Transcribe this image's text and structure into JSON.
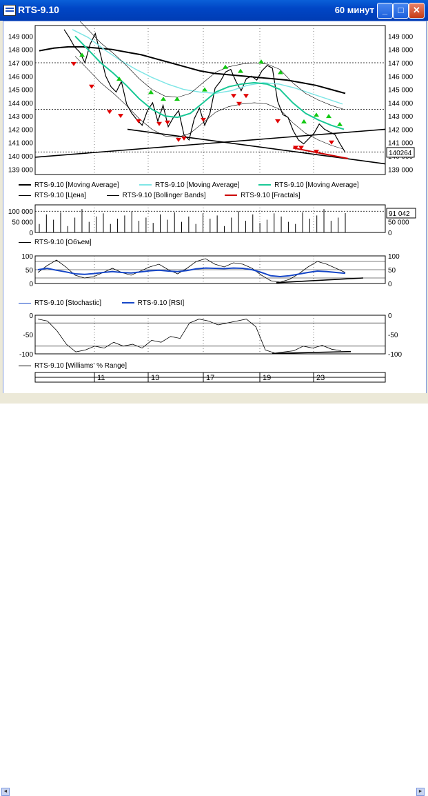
{
  "window": {
    "title": "RTS-9.10",
    "period": "60 минут",
    "btn_min": "_",
    "btn_max": "□",
    "btn_close": "✕"
  },
  "icons": {
    "app": "chart-window-icon",
    "minimize": "minimize-icon",
    "maximize": "maximize-icon",
    "close": "close-icon"
  },
  "colors": {
    "black_ma": "#000000",
    "light_ma": "#7fe6e6",
    "green_ma": "#19c896",
    "price": "#000000",
    "bollinger": "#000000",
    "fractals": "#cc0000",
    "rsi": "#1546c8",
    "stochastic": "#1546c8",
    "fractal_up": "#10c810",
    "fractal_down": "#e00000"
  },
  "price_panel": {
    "y_ticks": [
      "149 000",
      "148 000",
      "147 000",
      "146 000",
      "145 000",
      "144 000",
      "143 000",
      "142 000",
      "141 000",
      "140 000",
      "139 000"
    ],
    "current_label": "140264",
    "legend": [
      {
        "label": "RTS-9.10 [Moving Average]"
      },
      {
        "label": "RTS-9.10 [Moving Average]"
      },
      {
        "label": "RTS-9.10 [Moving Average]"
      },
      {
        "label": "RTS-9.10 [Цена]"
      },
      {
        "label": "RTS-9.10 [Bollinger Bands]"
      },
      {
        "label": "RTS-9.10 [Fractals]"
      }
    ]
  },
  "volume_panel": {
    "y_ticks": [
      "100 000",
      "50 000",
      "0"
    ],
    "current_label": "91 042",
    "legend": "RTS-9.10 [Объем]"
  },
  "osc_panel": {
    "y_ticks": [
      "100",
      "50",
      "0"
    ],
    "legend": [
      "RTS-9.10 [Stochastic]",
      "RTS-9.10 [RSI]"
    ]
  },
  "wpr_panel": {
    "y_ticks": [
      "0",
      "-50",
      "-100"
    ],
    "legend": "RTS-9.10 [Williams' % Range]"
  },
  "x_axis": {
    "dates": [
      "11",
      "13",
      "17",
      "19",
      "23"
    ]
  },
  "chart_data": [
    {
      "type": "line",
      "title": "",
      "ylabel": "",
      "ylim": [
        138600,
        149800
      ],
      "series": [
        {
          "name": "RTS-9.10 [Цена]",
          "values": [
            149500,
            148900,
            148200,
            147800,
            147000,
            148400,
            149200,
            147600,
            146000,
            145200,
            144800,
            145600,
            143900,
            143200,
            142700,
            142300,
            143400,
            144000,
            142600,
            143800,
            142200,
            142900,
            143400,
            141600,
            141200,
            142800,
            143600,
            142300,
            143200,
            145100,
            145600,
            146300,
            146500,
            145600,
            144900,
            145800,
            146000,
            145700,
            146400,
            146800,
            146600,
            144100,
            143100,
            142900,
            141900,
            141200,
            140900,
            141300,
            141700,
            142400,
            142000,
            141800,
            141600,
            140900,
            140264
          ]
        },
        {
          "name": "RTS-9.10 [Moving Average]",
          "values": [
            147900,
            148100,
            148200,
            148200,
            148100,
            148000,
            147800,
            147600,
            147300,
            147000,
            146700,
            146400,
            146200,
            146100,
            146000,
            145900,
            145800,
            145700,
            145500,
            145300,
            145000,
            144700
          ]
        },
        {
          "name": "RTS-9.10 [Moving Average]",
          "values": [
            149500,
            148900,
            148000,
            147200,
            146500,
            145900,
            145400,
            145000,
            144800,
            144700,
            144900,
            145300,
            145500,
            145400,
            145100,
            144700,
            144300,
            143900
          ]
        },
        {
          "name": "RTS-9.10 [Moving Average]",
          "values": [
            149000,
            148000,
            147000,
            146200,
            145300,
            144300,
            143500,
            143000,
            142900,
            143200,
            144000,
            144800,
            145200,
            145400,
            145500,
            145400,
            145000,
            144000,
            143200,
            142700,
            142300,
            142000
          ]
        }
      ]
    },
    {
      "type": "bar",
      "title": "",
      "ylabel": "",
      "ylim": [
        0,
        130000
      ],
      "series": [
        {
          "name": "RTS-9.10 [Объем]",
          "values": [
            40000,
            85000,
            60000,
            95000,
            30000,
            70000,
            110000,
            50000,
            75000,
            90000,
            40000,
            65000,
            80000,
            100000,
            55000,
            70000,
            45000,
            85000,
            60000,
            95000,
            50000,
            75000,
            40000,
            90000,
            65000,
            80000,
            30000,
            70000,
            100000,
            55000,
            85000,
            45000,
            60000,
            90000,
            75000,
            50000,
            40000,
            95000,
            65000,
            80000,
            110000,
            55000,
            70000,
            91042
          ]
        }
      ]
    },
    {
      "type": "line",
      "title": "",
      "ylabel": "",
      "ylim": [
        0,
        100
      ],
      "series": [
        {
          "name": "RTS-9.10 [Stochastic]",
          "values": [
            40,
            65,
            85,
            60,
            30,
            20,
            25,
            40,
            55,
            40,
            30,
            45,
            60,
            70,
            50,
            35,
            55,
            80,
            90,
            70,
            60,
            75,
            70,
            55,
            30,
            10,
            5,
            15,
            35,
            60,
            80,
            70,
            55,
            40
          ]
        },
        {
          "name": "RTS-9.10 [RSI]",
          "values": [
            50,
            55,
            48,
            42,
            35,
            33,
            36,
            40,
            43,
            40,
            38,
            42,
            46,
            48,
            45,
            43,
            47,
            53,
            56,
            55,
            54,
            56,
            55,
            50,
            40,
            28,
            25,
            28,
            34,
            40,
            45,
            43,
            40,
            37
          ]
        }
      ]
    },
    {
      "type": "line",
      "title": "",
      "ylabel": "",
      "ylim": [
        -100,
        0
      ],
      "series": [
        {
          "name": "RTS-9.10 [Williams' % Range]",
          "values": [
            -10,
            -15,
            -40,
            -75,
            -95,
            -90,
            -80,
            -85,
            -70,
            -80,
            -75,
            -85,
            -65,
            -70,
            -55,
            -60,
            -20,
            -10,
            -15,
            -25,
            -20,
            -15,
            -10,
            -30,
            -90,
            -98,
            -95,
            -92,
            -80,
            -85,
            -78,
            -88,
            -92
          ]
        }
      ]
    }
  ]
}
